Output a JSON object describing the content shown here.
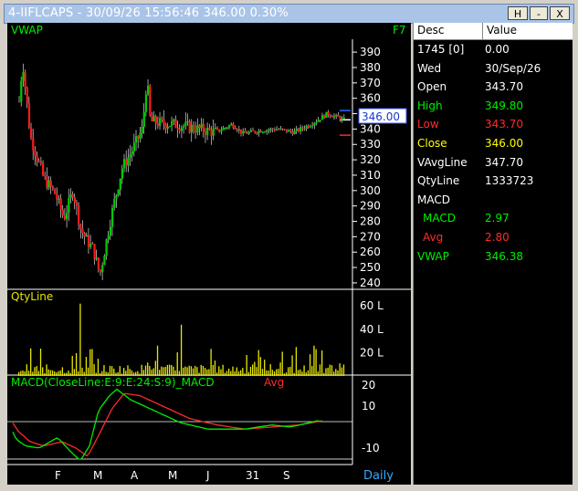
{
  "window": {
    "title": "4-IIFLCAPS - 30/09/26 15:56:46 346.00 0.30%",
    "buttons": [
      "H",
      "-",
      "X"
    ]
  },
  "chart": {
    "price_label": "VWAP",
    "hotkey": "F7",
    "current_price": "346.00",
    "qty_label": "QtyLine",
    "macd_label": "MACD(CloseLine:E:9:E:24:S:9)_MACD",
    "macd_avg_label": "Avg",
    "period": "Daily",
    "colors": {
      "up": "#00cc00",
      "down": "#ff1a1a",
      "wick": "#ffffff",
      "qty": "#e6e600",
      "axis": "#ffffff"
    }
  },
  "chart_data": [
    {
      "type": "candlestick",
      "title": "VWAP",
      "y_ticks": [
        390,
        380,
        370,
        360,
        350,
        340,
        330,
        320,
        310,
        300,
        290,
        280,
        270,
        260,
        250,
        240
      ],
      "ylim": [
        237,
        396
      ],
      "x_tick_labels": [
        "F",
        "M",
        "A",
        "M",
        "J",
        "31",
        "S"
      ],
      "last_close": 346.0
    },
    {
      "type": "bar",
      "title": "QtyLine",
      "y_ticks": [
        "60 L",
        "40 L",
        "20 L"
      ],
      "ylim": [
        0,
        68
      ]
    },
    {
      "type": "line",
      "title": "MACD(CloseLine:E:9:E:24:S:9)_MACD",
      "series": [
        {
          "name": "MACD"
        },
        {
          "name": "Avg"
        }
      ],
      "y_ticks": [
        "20",
        "10",
        "-10"
      ],
      "ylim": [
        -17,
        23
      ]
    }
  ],
  "info": {
    "headers": {
      "desc": "Desc",
      "value": "Value"
    },
    "rows": [
      {
        "k": "1745 [0]",
        "v": "0.00",
        "kc": "#ffffff",
        "vc": "#ffffff",
        "indent": false
      },
      {
        "k": "Wed",
        "v": "30/Sep/26",
        "kc": "#ffffff",
        "vc": "#ffffff",
        "indent": false
      },
      {
        "k": "Open",
        "v": "343.70",
        "kc": "#ffffff",
        "vc": "#ffffff",
        "indent": false
      },
      {
        "k": "High",
        "v": "349.80",
        "kc": "#00ee00",
        "vc": "#00ee00",
        "indent": false
      },
      {
        "k": "Low",
        "v": "343.70",
        "kc": "#ff2a2a",
        "vc": "#ff2a2a",
        "indent": false
      },
      {
        "k": "Close",
        "v": "346.00",
        "kc": "#ffff00",
        "vc": "#ffff00",
        "indent": false
      },
      {
        "k": "VAvgLine",
        "v": "347.70",
        "kc": "#ffffff",
        "vc": "#ffffff",
        "indent": false
      },
      {
        "k": "QtyLine",
        "v": "1333723",
        "kc": "#ffffff",
        "vc": "#ffffff",
        "indent": false
      },
      {
        "k": "MACD",
        "v": "",
        "kc": "#ffffff",
        "vc": "#ffffff",
        "indent": false
      },
      {
        "k": "MACD",
        "v": "2.97",
        "kc": "#00ee00",
        "vc": "#00ee00",
        "indent": true
      },
      {
        "k": "Avg",
        "v": "2.80",
        "kc": "#ff2a2a",
        "vc": "#ff2a2a",
        "indent": true
      },
      {
        "k": "VWAP",
        "v": "346.38",
        "kc": "#00ee00",
        "vc": "#00ee00",
        "indent": false
      }
    ]
  }
}
